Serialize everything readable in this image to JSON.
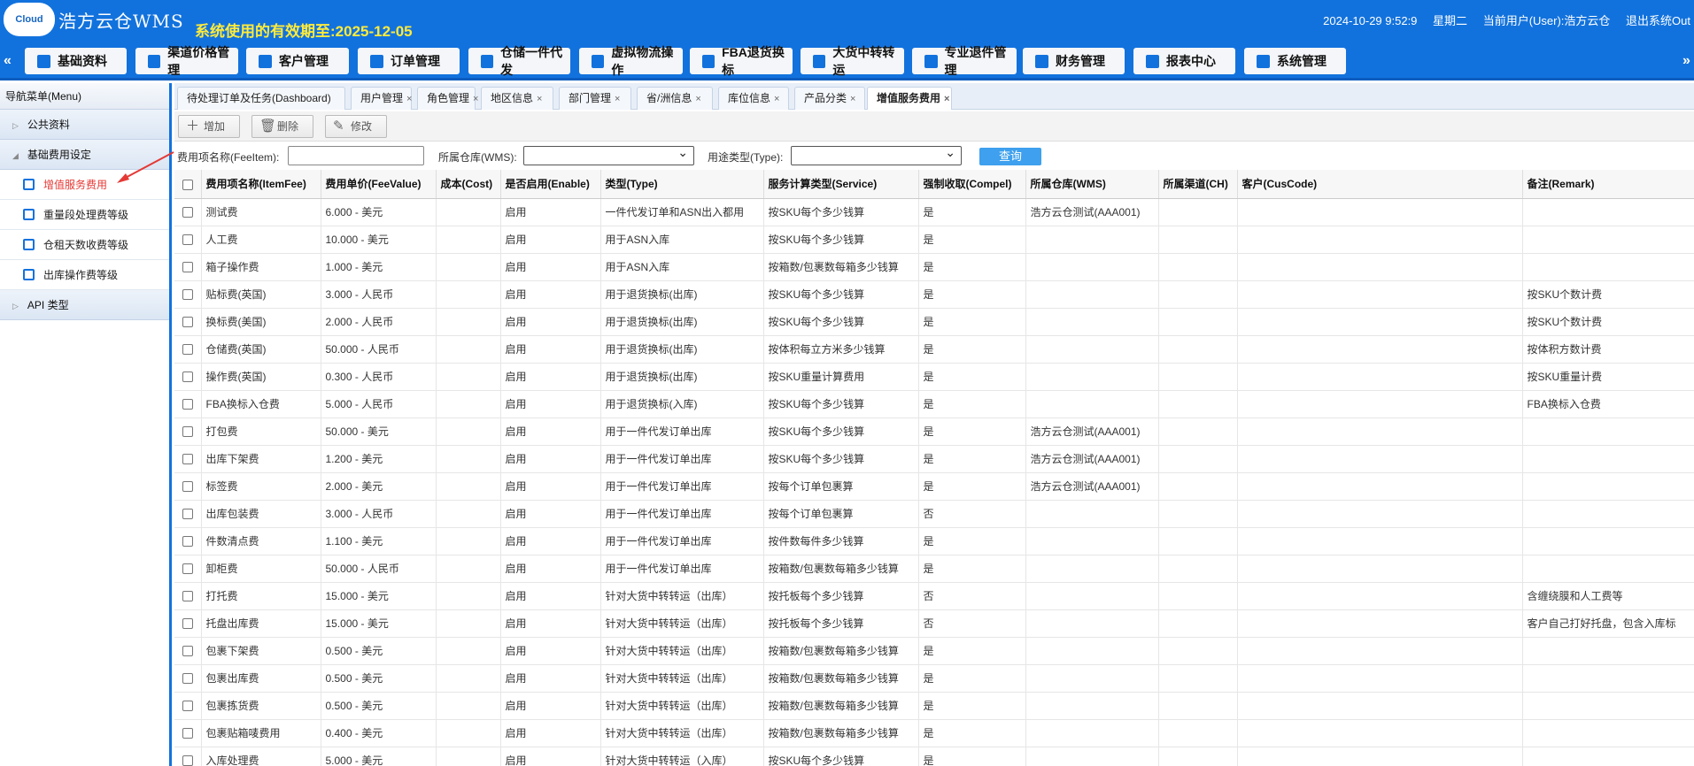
{
  "header": {
    "logo_text": "Cloud",
    "app_name": "浩方云仓WMS",
    "expire": "系统使用的有效期至:2025-12-05",
    "datetime": "2024-10-29 9:52:9",
    "weekday": "星期二",
    "user": "当前用户(User):浩方云仓",
    "logout": "退出系统Out"
  },
  "nav": [
    {
      "label": "基础资料",
      "icon": "tag-icon"
    },
    {
      "label": "渠道价格管理",
      "icon": "chart-icon"
    },
    {
      "label": "客户管理",
      "icon": "user-icon"
    },
    {
      "label": "订单管理",
      "icon": "list-icon"
    },
    {
      "label": "仓储一件代发",
      "icon": "house-icon"
    },
    {
      "label": "虚拟物流操作",
      "icon": "truck-icon"
    },
    {
      "label": "FBA退货换标",
      "icon": "fba-icon"
    },
    {
      "label": "大货中转转运",
      "icon": "truck-icon"
    },
    {
      "label": "专业退件管理",
      "icon": "truck-icon"
    },
    {
      "label": "财务管理",
      "icon": "finance-icon"
    },
    {
      "label": "报表中心",
      "icon": "database-icon"
    },
    {
      "label": "系统管理",
      "icon": "settings-icon"
    }
  ],
  "sidebar": {
    "title": "导航菜单(Menu)",
    "groups": [
      "公共资料",
      "基础费用设定",
      "API 类型"
    ],
    "items": [
      "增值服务费用",
      "重量段处理费等级",
      "仓租天数收费等级",
      "出库操作费等级"
    ]
  },
  "tabs": [
    "待处理订单及任务(Dashboard)",
    "用户管理",
    "角色管理",
    "地区信息",
    "部门管理",
    "省/洲信息",
    "库位信息",
    "产品分类",
    "增值服务费用"
  ],
  "toolbar": {
    "add": "增加",
    "delete": "删除",
    "edit": "修改"
  },
  "filter": {
    "fee_label": "费用项名称(FeeItem):",
    "wms_label": "所属仓库(WMS):",
    "type_label": "用途类型(Type):",
    "search": "查询"
  },
  "columns": [
    "费用项名称(ItemFee)",
    "费用单价(FeeValue)",
    "成本(Cost)",
    "是否启用(Enable)",
    "类型(Type)",
    "服务计算类型(Service)",
    "强制收取(Compel)",
    "所属仓库(WMS)",
    "所属渠道(CH)",
    "客户(CusCode)",
    "备注(Remark)"
  ],
  "rows": [
    [
      "测试费",
      "6.000 - 美元",
      "",
      "启用",
      "一件代发订单和ASN出入都用",
      "按SKU每个多少钱算",
      "是",
      "浩方云仓测试(AAA001)",
      "",
      "",
      ""
    ],
    [
      "人工费",
      "10.000 - 美元",
      "",
      "启用",
      "用于ASN入库",
      "按SKU每个多少钱算",
      "是",
      "",
      "",
      "",
      ""
    ],
    [
      "箱子操作费",
      "1.000 - 美元",
      "",
      "启用",
      "用于ASN入库",
      "按箱数/包裹数每箱多少钱算",
      "是",
      "",
      "",
      "",
      ""
    ],
    [
      "贴标费(英国)",
      "3.000 - 人民币",
      "",
      "启用",
      "用于退货换标(出库)",
      "按SKU每个多少钱算",
      "是",
      "",
      "",
      "",
      "按SKU个数计费"
    ],
    [
      "换标费(美国)",
      "2.000 - 人民币",
      "",
      "启用",
      "用于退货换标(出库)",
      "按SKU每个多少钱算",
      "是",
      "",
      "",
      "",
      "按SKU个数计费"
    ],
    [
      "仓储费(英国)",
      "50.000 - 人民币",
      "",
      "启用",
      "用于退货换标(出库)",
      "按体积每立方米多少钱算",
      "是",
      "",
      "",
      "",
      "按体积方数计费"
    ],
    [
      "操作费(英国)",
      "0.300 - 人民币",
      "",
      "启用",
      "用于退货换标(出库)",
      "按SKU重量计算费用",
      "是",
      "",
      "",
      "",
      "按SKU重量计费"
    ],
    [
      "FBA换标入仓费",
      "5.000 - 人民币",
      "",
      "启用",
      "用于退货换标(入库)",
      "按SKU每个多少钱算",
      "是",
      "",
      "",
      "",
      "FBA换标入仓费"
    ],
    [
      "打包费",
      "50.000 - 美元",
      "",
      "启用",
      "用于一件代发订单出库",
      "按SKU每个多少钱算",
      "是",
      "浩方云仓测试(AAA001)",
      "",
      "",
      ""
    ],
    [
      "出库下架费",
      "1.200 - 美元",
      "",
      "启用",
      "用于一件代发订单出库",
      "按SKU每个多少钱算",
      "是",
      "浩方云仓测试(AAA001)",
      "",
      "",
      ""
    ],
    [
      "标签费",
      "2.000 - 美元",
      "",
      "启用",
      "用于一件代发订单出库",
      "按每个订单包裹算",
      "是",
      "浩方云仓测试(AAA001)",
      "",
      "",
      ""
    ],
    [
      "出库包装费",
      "3.000 - 人民币",
      "",
      "启用",
      "用于一件代发订单出库",
      "按每个订单包裹算",
      "否",
      "",
      "",
      "",
      ""
    ],
    [
      "件数清点费",
      "1.100 - 美元",
      "",
      "启用",
      "用于一件代发订单出库",
      "按件数每件多少钱算",
      "是",
      "",
      "",
      "",
      ""
    ],
    [
      "卸柜费",
      "50.000 - 人民币",
      "",
      "启用",
      "用于一件代发订单出库",
      "按箱数/包裹数每箱多少钱算",
      "是",
      "",
      "",
      "",
      ""
    ],
    [
      "打托费",
      "15.000 - 美元",
      "",
      "启用",
      "针对大货中转转运（出库）",
      "按托板每个多少钱算",
      "否",
      "",
      "",
      "",
      "含缠绕膜和人工费等"
    ],
    [
      "托盘出库费",
      "15.000 - 美元",
      "",
      "启用",
      "针对大货中转转运（出库）",
      "按托板每个多少钱算",
      "否",
      "",
      "",
      "",
      "客户自己打好托盘，包含入库标"
    ],
    [
      "包裹下架费",
      "0.500 - 美元",
      "",
      "启用",
      "针对大货中转转运（出库）",
      "按箱数/包裹数每箱多少钱算",
      "是",
      "",
      "",
      "",
      ""
    ],
    [
      "包裹出库费",
      "0.500 - 美元",
      "",
      "启用",
      "针对大货中转转运（出库）",
      "按箱数/包裹数每箱多少钱算",
      "是",
      "",
      "",
      "",
      ""
    ],
    [
      "包裹拣货费",
      "0.500 - 美元",
      "",
      "启用",
      "针对大货中转转运（出库）",
      "按箱数/包裹数每箱多少钱算",
      "是",
      "",
      "",
      "",
      ""
    ],
    [
      "包裹贴箱唛费用",
      "0.400 - 美元",
      "",
      "启用",
      "针对大货中转转运（出库）",
      "按箱数/包裹数每箱多少钱算",
      "是",
      "",
      "",
      "",
      ""
    ],
    [
      "入库处理费",
      "5.000 - 美元",
      "",
      "启用",
      "针对大货中转转运（入库）",
      "按SKU每个多少钱算",
      "是",
      "",
      "",
      "",
      ""
    ]
  ],
  "colors": {
    "primary": "#1272dd",
    "accent_yellow": "#ffeb3b",
    "active_red": "#e53935",
    "search_btn": "#3ea0ee"
  }
}
